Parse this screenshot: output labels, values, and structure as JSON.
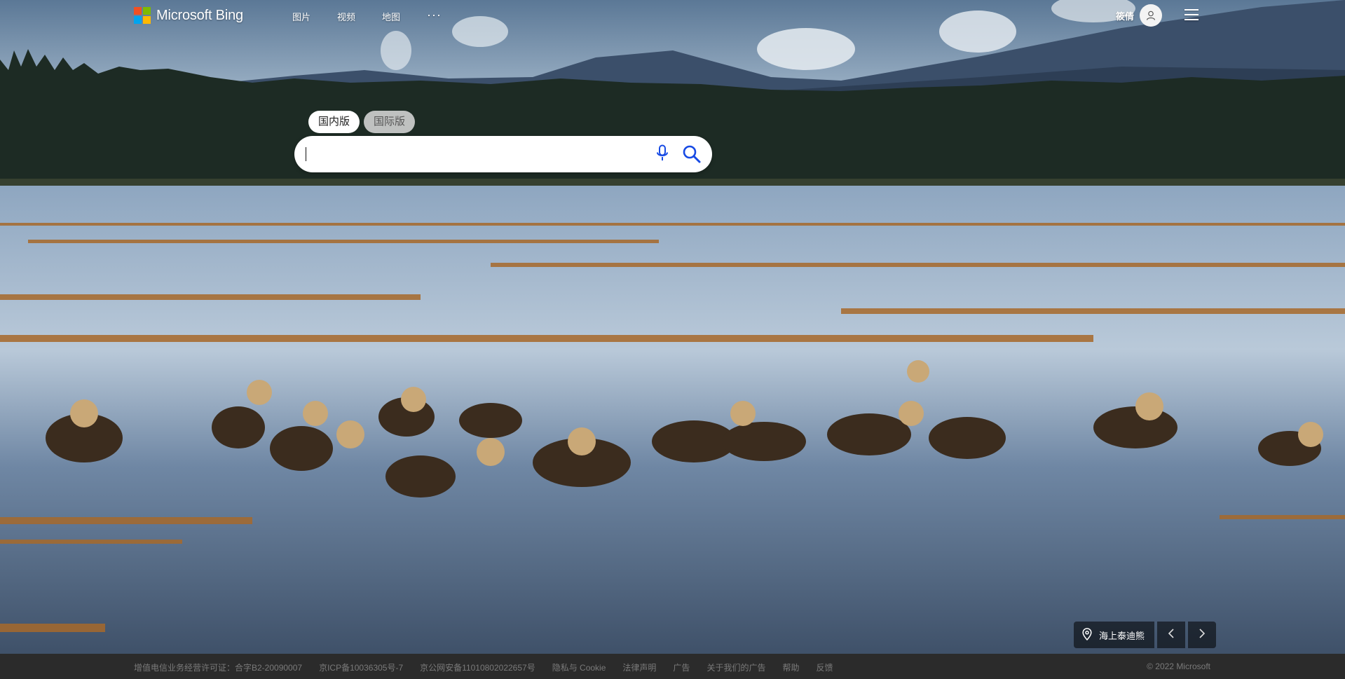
{
  "brand": {
    "name": "Microsoft Bing",
    "logo_colors": [
      "#f25022",
      "#7fba00",
      "#00a4ef",
      "#ffb900"
    ]
  },
  "nav": {
    "items": [
      {
        "label": "图片"
      },
      {
        "label": "视频"
      },
      {
        "label": "地图"
      }
    ],
    "more": "···"
  },
  "account": {
    "name": "筱倩",
    "icon": "user-icon"
  },
  "menu": {
    "icon": "hamburger-icon"
  },
  "search": {
    "tabs": [
      {
        "label": "国内版",
        "active": true
      },
      {
        "label": "国际版",
        "active": false
      }
    ],
    "value": "",
    "placeholder": "",
    "mic_icon": "microphone-icon",
    "search_icon": "search-icon",
    "accent": "#174ae4"
  },
  "image_info": {
    "location": "海上泰迪熊",
    "location_icon": "map-pin-icon",
    "prev_icon": "chevron-left-icon",
    "next_icon": "chevron-right-icon"
  },
  "footer": {
    "links": [
      {
        "label": "增值电信业务经营许可证：合字B2-20090007"
      },
      {
        "label": "京ICP备10036305号-7"
      },
      {
        "label": "京公网安备11010802022657号"
      },
      {
        "label": "隐私与 Cookie"
      },
      {
        "label": "法律声明"
      },
      {
        "label": "广告"
      },
      {
        "label": "关于我们的广告"
      },
      {
        "label": "帮助"
      },
      {
        "label": "反馈"
      }
    ],
    "copyright": "© 2022 Microsoft"
  }
}
